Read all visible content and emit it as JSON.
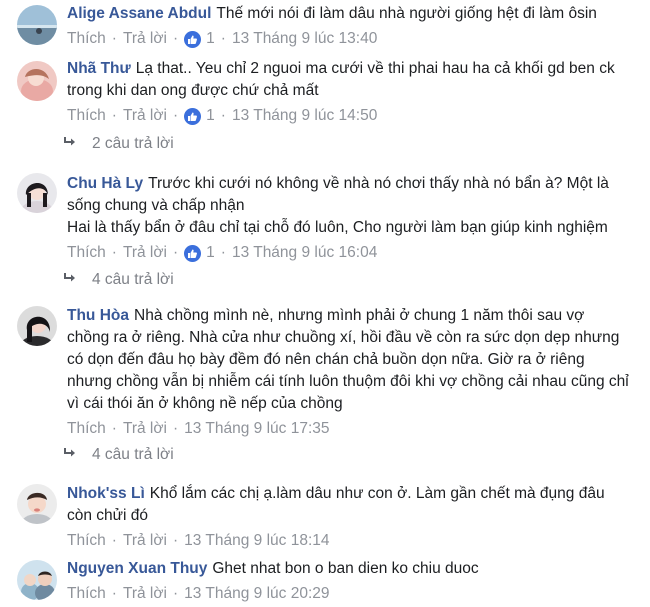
{
  "comments": [
    {
      "author": "Alige Assane Abdul",
      "text": "Thế mới nói đi làm dâu nhà người giống hệt đi làm ôsin",
      "like_label": "Thích",
      "reply_label": "Trả lời",
      "likes": "1",
      "time": "13 Tháng 9 lúc 13:40"
    },
    {
      "author": "Nhã Thư",
      "text": "Lạ that.. Yeu chỉ 2 nguoi ma cưới về thi phai hau ha cả khối gd ben ck trong khi dan ong được chứ chả mất",
      "like_label": "Thích",
      "reply_label": "Trả lời",
      "likes": "1",
      "time": "13 Tháng 9 lúc 14:50",
      "replies": "2 câu trả lời"
    },
    {
      "author": "Chu Hà Ly",
      "text": "Trước khi cưới nó không về nhà nó chơi thấy nhà nó bẩn à? Một là sống chung và chấp nhận\nHai là thấy bẩn ở đâu chỉ tại chỗ đó luôn, Cho người làm bạn giúp kinh nghiệm",
      "like_label": "Thích",
      "reply_label": "Trả lời",
      "likes": "1",
      "time": "13 Tháng 9 lúc 16:04",
      "replies": "4 câu trả lời"
    },
    {
      "author": "Thu Hòa",
      "text": "Nhà chồng mình nè, nhưng mình phải ở chung 1 năm thôi sau vợ chồng ra ở riêng. Nhà cửa như chuồng xí, hồi đầu về còn ra sức dọn dẹp nhưng có dọn đến đâu họ bày đềm đó nên chán chả buồn dọn nữa. Giờ ra ở riêng nhưng chồng vẫn bị nhiễm cái tính luôn thuộm đôi khi vợ chồng cải nhau cũng chỉ vì cái thói ăn ở không nề nếp của chồng",
      "like_label": "Thích",
      "reply_label": "Trả lời",
      "time": "13 Tháng 9 lúc 17:35",
      "replies": "4 câu trả lời"
    },
    {
      "author": "Nhok'ss Lì",
      "text": "Khổ lắm các chị ạ.làm dâu như con ở. Làm gần chết mà đụng đâu còn chửi đó",
      "like_label": "Thích",
      "reply_label": "Trả lời",
      "time": "13 Tháng 9 lúc 18:14"
    },
    {
      "author": "Nguyen Xuan Thuy",
      "text": "Ghet nhat bon o ban dien ko chiu duoc",
      "like_label": "Thích",
      "reply_label": "Trả lời",
      "time": "13 Tháng 9 lúc 20:29"
    }
  ],
  "colors": {
    "author": "#385898",
    "meta": "#8f939a",
    "like_badge": "#3b6fdc"
  },
  "icons": [
    "thumbs-up-icon",
    "reply-arrow-icon"
  ]
}
